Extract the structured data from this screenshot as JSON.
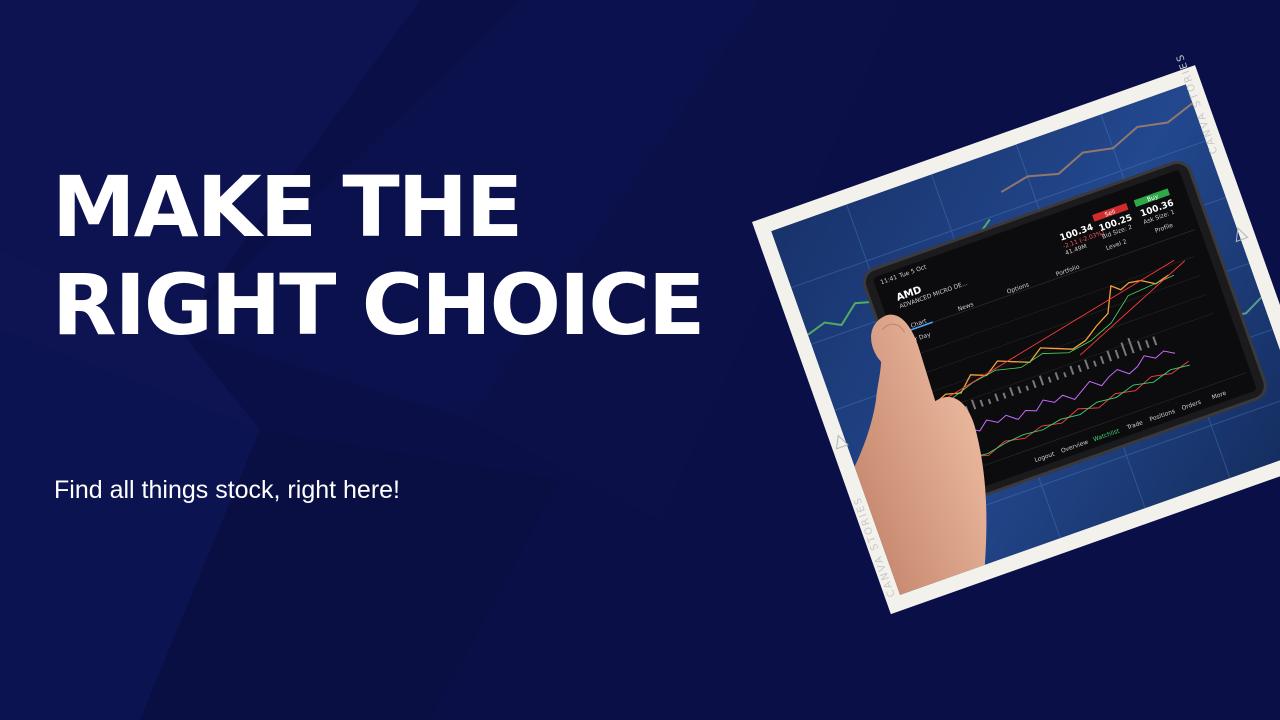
{
  "headline": {
    "line1": "MAKE THE",
    "line2": "RIGHT CHOICE"
  },
  "subline": "Find all things stock, right here!",
  "photo": {
    "watermark": "CANVA STORIES",
    "tablet": {
      "time": "11:41",
      "date": "Tue 5 Oct",
      "ticker": "AMD",
      "company": "ADVANCED MICRO DE...",
      "last_price": "100.34",
      "change": "-2.11 (-2.03%)",
      "volume": "41.49M",
      "sell_label": "Sell",
      "buy_label": "Buy",
      "bid_price": "100.25",
      "bid_size": "Bid Size: 2",
      "ask_price": "100.36",
      "ask_size": "Ask Size: 1",
      "level_label": "Level 2",
      "profile_label": "Profile",
      "tabs": [
        "Chart",
        "News",
        "Options",
        "Portfolio"
      ],
      "period": "1Yr Day",
      "bottom_nav": [
        "Logout",
        "Overview",
        "Watchlist",
        "Trade",
        "Positions",
        "Orders",
        "More"
      ]
    }
  },
  "colors": {
    "background": "#0a0f47",
    "text": "#ffffff",
    "frame": "#f3f1ec"
  }
}
